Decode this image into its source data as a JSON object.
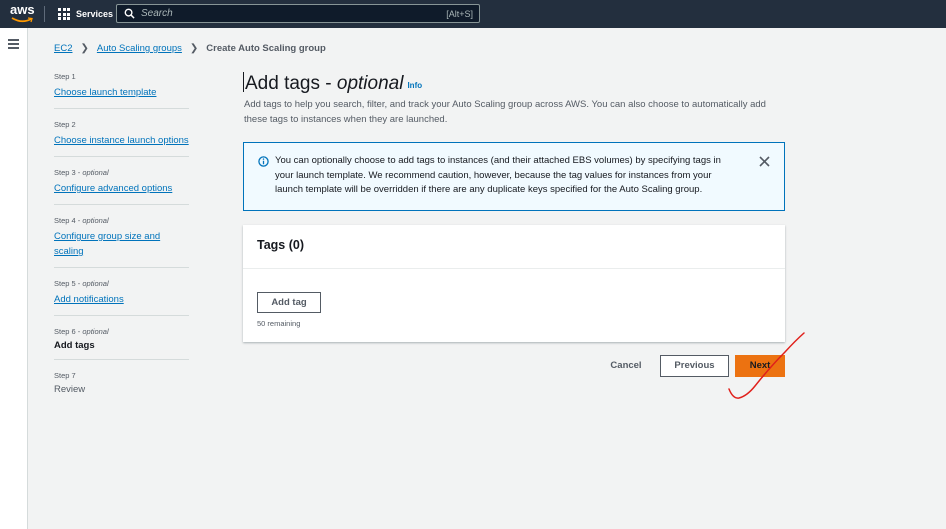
{
  "topnav": {
    "logo": "aws",
    "services_label": "Services",
    "search_placeholder": "Search",
    "search_shortcut": "[Alt+S]"
  },
  "breadcrumb": {
    "items": [
      "EC2",
      "Auto Scaling groups"
    ],
    "current": "Create Auto Scaling group"
  },
  "steps": [
    {
      "label": "Step 1",
      "optional": "",
      "title": "Choose launch template",
      "state": "link"
    },
    {
      "label": "Step 2",
      "optional": "",
      "title": "Choose instance launch options",
      "state": "link"
    },
    {
      "label": "Step 3 - ",
      "optional": "optional",
      "title": "Configure advanced options",
      "state": "link"
    },
    {
      "label": "Step 4 - ",
      "optional": "optional",
      "title": "Configure group size and scaling",
      "state": "link"
    },
    {
      "label": "Step 5 - ",
      "optional": "optional",
      "title": "Add notifications",
      "state": "link"
    },
    {
      "label": "Step 6 - ",
      "optional": "optional",
      "title": "Add tags",
      "state": "current"
    },
    {
      "label": "Step 7",
      "optional": "",
      "title": "Review",
      "state": "disabled"
    }
  ],
  "main": {
    "title": "Add tags - ",
    "title_optional": "optional",
    "info": "Info",
    "description": "Add tags to help you search, filter, and track your Auto Scaling group across AWS. You can also choose to automatically add these tags to instances when they are launched.",
    "alert_text": "You can optionally choose to add tags to instances (and their attached EBS volumes) by specifying tags in your launch template. We recommend caution, however, because the tag values for instances from your launch template will be overridden if there are any duplicate keys specified for the Auto Scaling group.",
    "panel_title": "Tags (0)",
    "add_tag_label": "Add tag",
    "remaining": "50 remaining"
  },
  "footer": {
    "cancel": "Cancel",
    "previous": "Previous",
    "next": "Next"
  },
  "colors": {
    "nav_bg": "#232f3e",
    "link": "#0073bb",
    "primary": "#ec7211",
    "annotation": "#e0201b"
  }
}
